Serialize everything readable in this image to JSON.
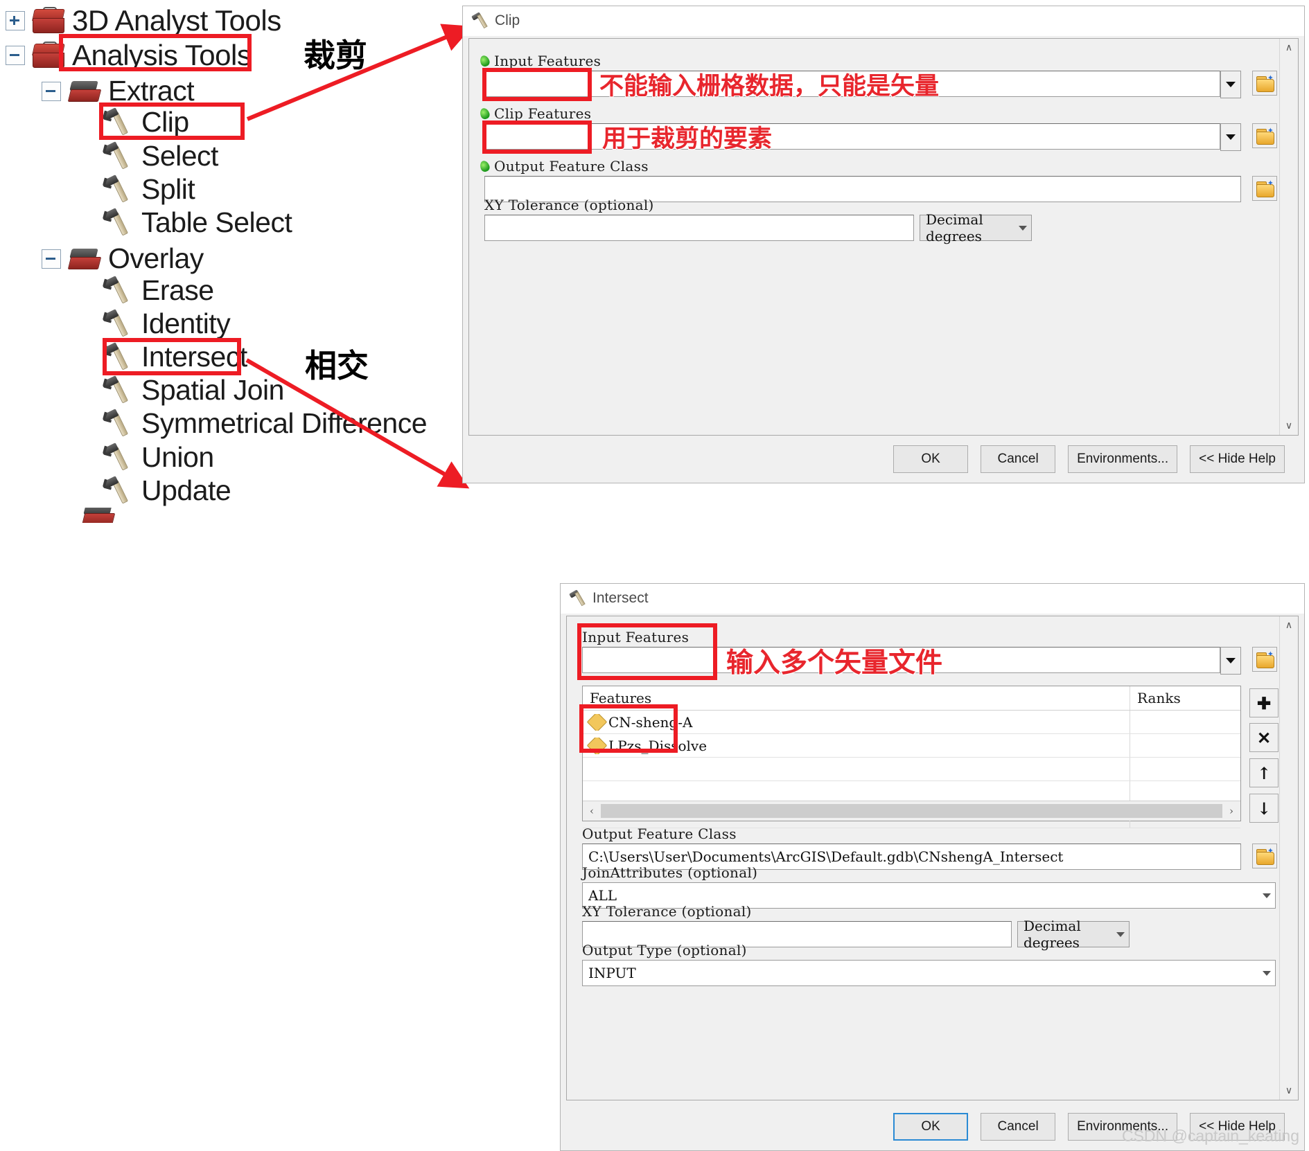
{
  "toolbox_tree": {
    "items": [
      {
        "label": "3D Analyst Tools",
        "icon": "toolbox-icon",
        "level": 0,
        "expander": "plus"
      },
      {
        "label": "Analysis Tools",
        "icon": "toolbox-icon",
        "level": 0,
        "expander": "minus",
        "highlighted": true
      },
      {
        "label": "Extract",
        "icon": "toolset-icon",
        "level": 1,
        "expander": "minus"
      },
      {
        "label": "Clip",
        "icon": "hammer-icon",
        "level": 2,
        "highlighted": true
      },
      {
        "label": "Select",
        "icon": "hammer-icon",
        "level": 2
      },
      {
        "label": "Split",
        "icon": "hammer-icon",
        "level": 2
      },
      {
        "label": "Table Select",
        "icon": "hammer-icon",
        "level": 2
      },
      {
        "label": "Overlay",
        "icon": "toolset-icon",
        "level": 1,
        "expander": "minus"
      },
      {
        "label": "Erase",
        "icon": "hammer-icon",
        "level": 2
      },
      {
        "label": "Identity",
        "icon": "hammer-icon",
        "level": 2
      },
      {
        "label": "Intersect",
        "icon": "hammer-icon",
        "level": 2,
        "highlighted": true
      },
      {
        "label": "Spatial Join",
        "icon": "hammer-icon",
        "level": 2
      },
      {
        "label": "Symmetrical Difference",
        "icon": "hammer-icon",
        "level": 2
      },
      {
        "label": "Union",
        "icon": "hammer-icon",
        "level": 2
      },
      {
        "label": "Update",
        "icon": "hammer-icon",
        "level": 2
      }
    ]
  },
  "annotations": {
    "clip_callout": "裁剪",
    "intersect_callout": "相交",
    "clip_input_note": "不能输入栅格数据，只能是矢量",
    "clip_clipfeat_note": "用于裁剪的要素",
    "intersect_input_note": "输入多个矢量文件",
    "accent_red": "#ed1c24"
  },
  "clip_dialog": {
    "title": "Clip",
    "fields": {
      "input_features": {
        "label": "Input Features",
        "value": "",
        "required": true
      },
      "clip_features": {
        "label": "Clip Features",
        "value": "",
        "required": true
      },
      "output_feature_class": {
        "label": "Output Feature Class",
        "value": "",
        "required": true
      },
      "xy_tolerance": {
        "label": "XY Tolerance (optional)",
        "value": "",
        "unit": "Decimal degrees"
      }
    },
    "buttons": {
      "ok": "OK",
      "cancel": "Cancel",
      "environments": "Environments...",
      "hide_help": "<< Hide Help"
    }
  },
  "intersect_dialog": {
    "title": "Intersect",
    "fields": {
      "input_features": {
        "label": "Input Features",
        "value": ""
      },
      "output_feature_class": {
        "label": "Output Feature Class",
        "value": "C:\\Users\\User\\Documents\\ArcGIS\\Default.gdb\\CNshengA_Intersect"
      },
      "join_attributes": {
        "label": "JoinAttributes (optional)",
        "value": "ALL"
      },
      "xy_tolerance": {
        "label": "XY Tolerance (optional)",
        "value": "",
        "unit": "Decimal degrees"
      },
      "output_type": {
        "label": "Output Type (optional)",
        "value": "INPUT"
      }
    },
    "features_grid": {
      "columns": [
        "Features",
        "Ranks"
      ],
      "rows": [
        {
          "feature": "CN-sheng-A",
          "rank": ""
        },
        {
          "feature": "LPzs_Dissolve",
          "rank": ""
        }
      ],
      "empty_rows": 4
    },
    "list_buttons": {
      "add": "✚",
      "remove": "✕",
      "up": "↑",
      "down": "↓"
    },
    "buttons": {
      "ok": "OK",
      "cancel": "Cancel",
      "environments": "Environments...",
      "hide_help": "<< Hide Help"
    }
  },
  "watermark": "CSDN @captain_keating"
}
